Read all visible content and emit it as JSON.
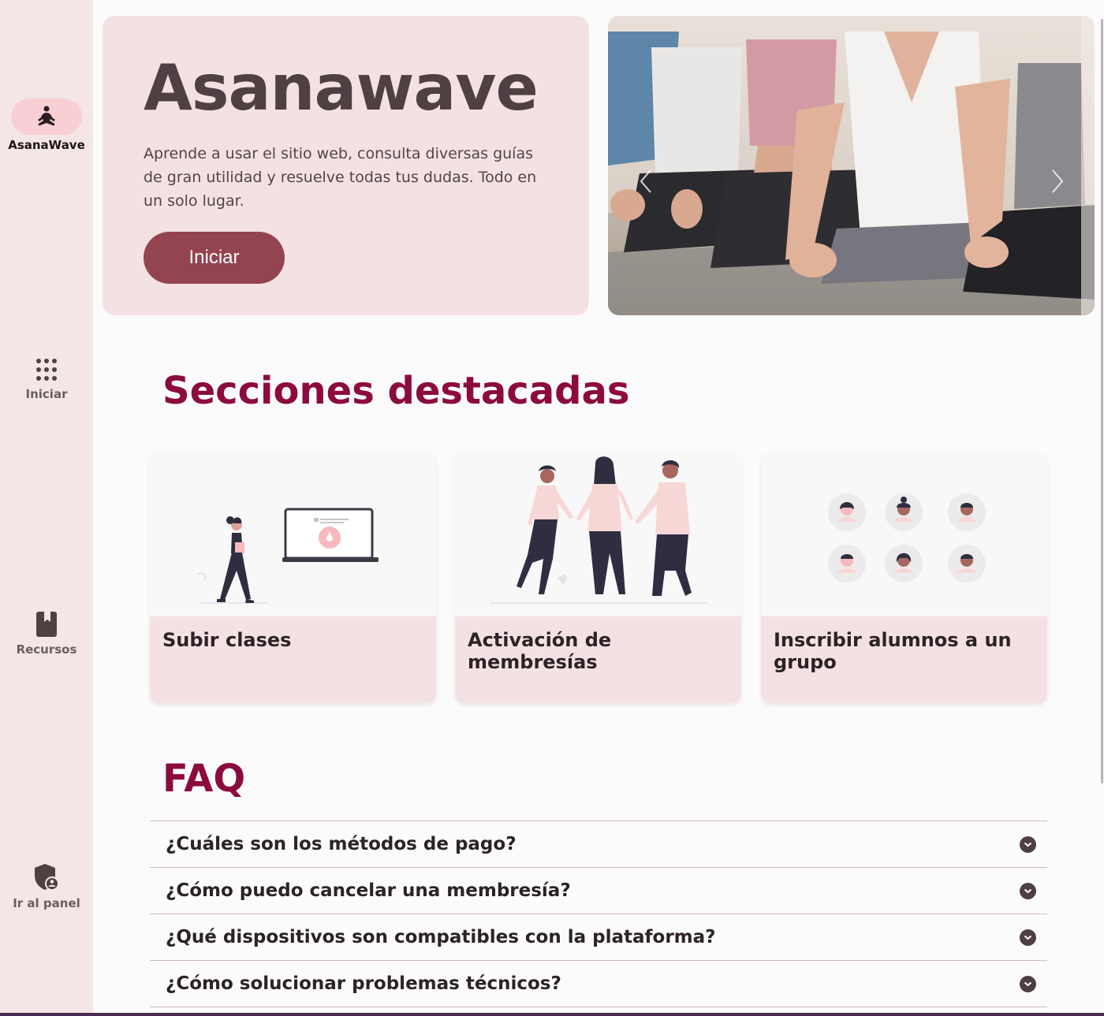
{
  "sidebar": {
    "brand": {
      "label": "AsanaWave",
      "icon": "meditation-icon"
    },
    "items": [
      {
        "label": "Iniciar",
        "icon": "apps-grid-icon"
      },
      {
        "label": "Recursos",
        "icon": "book-icon"
      },
      {
        "label": "Ir al panel",
        "icon": "admin-shield-icon"
      }
    ]
  },
  "hero": {
    "title": "Asanawave",
    "description": "Aprende a usar el sitio web, consulta diversas guías de gran utilidad y resuelve todas tus dudas. Todo en un solo lugar.",
    "button_label": "Iniciar"
  },
  "carousel": {
    "image": "yoga-class-photo",
    "prev_icon": "chevron-left-icon",
    "next_icon": "chevron-right-icon"
  },
  "featured": {
    "title": "Secciones destacadas",
    "cards": [
      {
        "title": "Subir clases",
        "illustration": "woman-laptop-illustration"
      },
      {
        "title": "Activación de membresías",
        "illustration": "people-holding-hands-illustration"
      },
      {
        "title": "Inscribir alumnos a un grupo",
        "illustration": "avatars-group-illustration"
      }
    ]
  },
  "faq": {
    "title": "FAQ",
    "items": [
      {
        "question": "¿Cuáles son los métodos de pago?"
      },
      {
        "question": "¿Cómo puedo cancelar una membresía?"
      },
      {
        "question": "¿Qué dispositivos son compatibles con la plataforma?"
      },
      {
        "question": "¿Cómo solucionar problemas técnicos?"
      }
    ]
  },
  "colors": {
    "accent": "#8c0b3e",
    "button": "#944450",
    "sidebar_bg": "#f4e5e7",
    "card_bg": "#f4e1e3",
    "active_pill": "#f8cfd3"
  }
}
